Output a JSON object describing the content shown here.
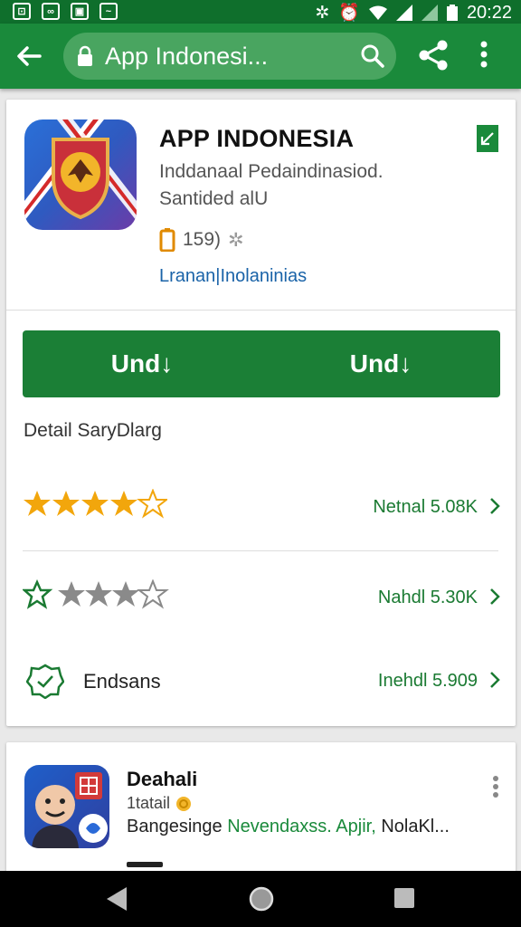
{
  "status_bar": {
    "time": "20:22",
    "left_icons": [
      "gallery-icon",
      "voicemail-icon",
      "photo-icon",
      "chat-icon"
    ],
    "right_icons": [
      "bug-icon",
      "alarm-icon",
      "wifi-icon",
      "signal-icon",
      "signal-icon",
      "battery-icon"
    ]
  },
  "toolbar": {
    "search_text": "App Indonesi...",
    "background": "#1a8a3b"
  },
  "app": {
    "title": "APP INDONESIA",
    "developer": "Inddanaal Pedaindinasiod.",
    "category": "Santided alU",
    "rating_text": "159)",
    "link_text": "Lranan|Inolaninias"
  },
  "actions": {
    "left_label": "Und↓",
    "right_label": "Und↓",
    "accent": "#1b7f36"
  },
  "details": {
    "section_title": "Detail SaryDlarg",
    "rows": [
      {
        "stars": 4,
        "label": "",
        "value": "Netnal 5.08K"
      },
      {
        "stars": 3,
        "label": "",
        "value": "Nahdl 5.30K"
      },
      {
        "stars": 0,
        "label": "Endsans",
        "value": "Inehdl 5.909"
      }
    ]
  },
  "related": {
    "title": "Deahali",
    "subtitle": "1tatail",
    "desc_prefix": "Bangesinge",
    "desc_highlight": "Nevendaxss. Apjir,",
    "desc_suffix": "NolaKl..."
  }
}
